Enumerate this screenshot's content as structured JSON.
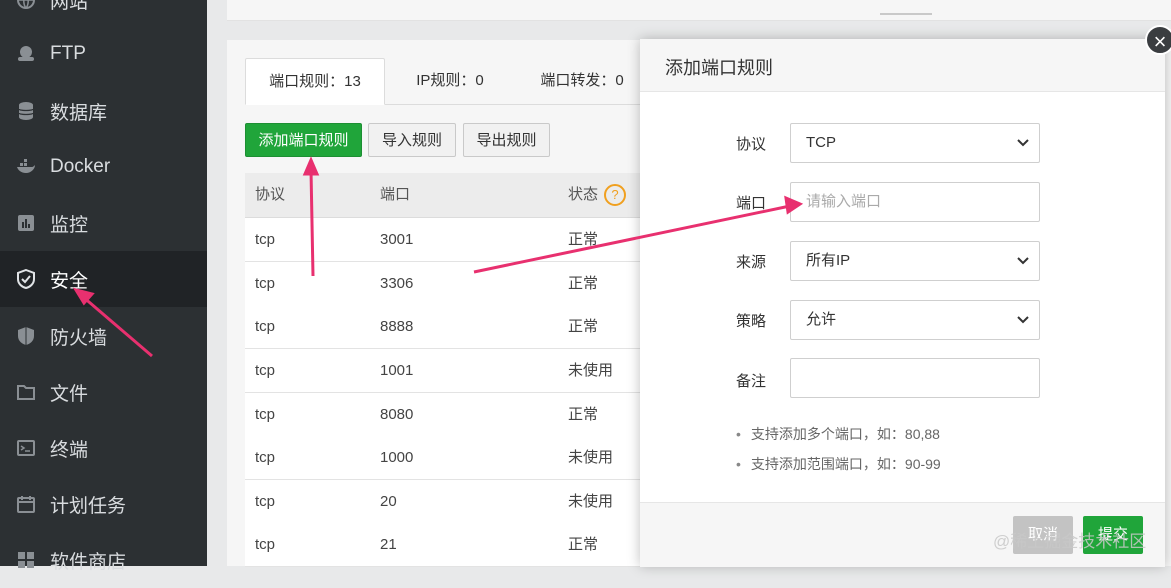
{
  "sidebar": {
    "items": [
      {
        "label": "网站",
        "icon": "globe-icon"
      },
      {
        "label": "FTP",
        "icon": "ftp-icon"
      },
      {
        "label": "数据库",
        "icon": "database-icon"
      },
      {
        "label": "Docker",
        "icon": "docker-icon"
      },
      {
        "label": "监控",
        "icon": "monitor-icon"
      },
      {
        "label": "安全",
        "icon": "shield-icon",
        "active": true
      },
      {
        "label": "防火墙",
        "icon": "firewall-icon"
      },
      {
        "label": "文件",
        "icon": "folder-icon"
      },
      {
        "label": "终端",
        "icon": "terminal-icon"
      },
      {
        "label": "计划任务",
        "icon": "calendar-icon"
      },
      {
        "label": "软件商店",
        "icon": "store-icon"
      }
    ]
  },
  "tabs": [
    {
      "label": "端口规则：13",
      "active": true
    },
    {
      "label": "IP规则：0"
    },
    {
      "label": "端口转发：0"
    }
  ],
  "toolbar": {
    "add_port_rule": "添加端口规则",
    "import_rules": "导入规则",
    "export_rules": "导出规则"
  },
  "table": {
    "headers": {
      "protocol": "协议",
      "port": "端口",
      "status": "状态"
    },
    "help_icon_text": "?",
    "rows": [
      {
        "protocol": "tcp",
        "port": "3001",
        "status": "正常"
      },
      {
        "protocol": "tcp",
        "port": "3306",
        "status": "正常"
      },
      {
        "protocol": "tcp",
        "port": "8888",
        "status": "正常"
      },
      {
        "protocol": "tcp",
        "port": "1001",
        "status": "未使用"
      },
      {
        "protocol": "tcp",
        "port": "8080",
        "status": "正常"
      },
      {
        "protocol": "tcp",
        "port": "1000",
        "status": "未使用"
      },
      {
        "protocol": "tcp",
        "port": "20",
        "status": "未使用"
      },
      {
        "protocol": "tcp",
        "port": "21",
        "status": "正常"
      }
    ]
  },
  "dialog": {
    "title": "添加端口规则",
    "close_symbol": "×",
    "fields": {
      "protocol": {
        "label": "协议",
        "value": "TCP"
      },
      "port": {
        "label": "端口",
        "placeholder": "请输入端口"
      },
      "source": {
        "label": "来源",
        "value": "所有IP"
      },
      "policy": {
        "label": "策略",
        "value": "允许"
      },
      "remark": {
        "label": "备注",
        "value": ""
      }
    },
    "tips": [
      "支持添加多个端口，如：80,88",
      "支持添加范围端口，如：90-99"
    ],
    "cancel_label": "取消",
    "submit_label": "提交"
  },
  "watermark": "@稀土掘金技术社区",
  "colors": {
    "sidebar_bg": "#2c3033",
    "accent_green": "#20a53a",
    "arrow": "#e8306f",
    "help_orange": "#f0a020"
  }
}
